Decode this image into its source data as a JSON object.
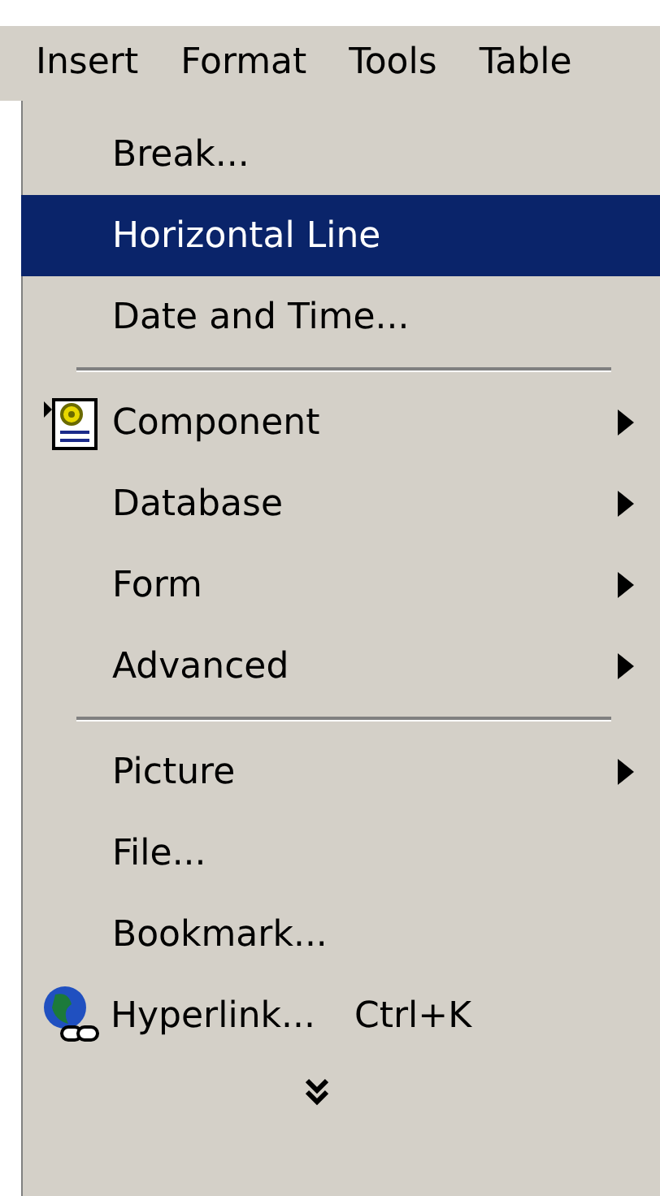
{
  "menu_bar": [
    {
      "label": "Insert",
      "selected": true
    },
    {
      "label": "Format",
      "selected": false
    },
    {
      "label": "Tools",
      "selected": false
    },
    {
      "label": "Table",
      "selected": false
    }
  ],
  "menu": [
    {
      "kind": "item",
      "label": "Break...",
      "selected": false
    },
    {
      "kind": "item",
      "label": "Horizontal Line",
      "selected": true
    },
    {
      "kind": "item",
      "label": "Date and Time...",
      "selected": false
    },
    {
      "kind": "separator"
    },
    {
      "kind": "gear-submenu",
      "label": "Component",
      "selected": false
    },
    {
      "kind": "submenu",
      "label": "Database",
      "selected": false
    },
    {
      "kind": "submenu",
      "label": "Form",
      "selected": false
    },
    {
      "kind": "submenu",
      "label": "Advanced",
      "selected": false
    },
    {
      "kind": "separator"
    },
    {
      "kind": "submenu",
      "label": "Picture",
      "selected": false
    },
    {
      "kind": "item",
      "label": "File...",
      "selected": false
    },
    {
      "kind": "item",
      "label": "Bookmark...",
      "selected": false
    },
    {
      "kind": "globe-item",
      "label": "Hyperlink...",
      "shortcut": "Ctrl+K",
      "selected": false
    },
    {
      "kind": "expand"
    }
  ]
}
